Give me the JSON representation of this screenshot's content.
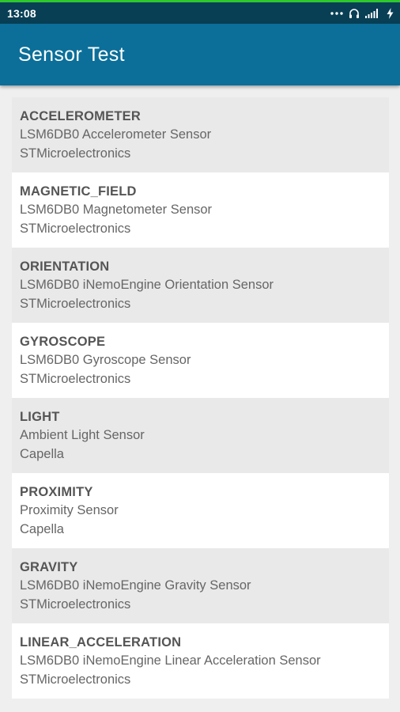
{
  "status_bar": {
    "time": "13:08",
    "icons": [
      "more-dots-icon",
      "headphones-icon",
      "signal-icon",
      "charging-icon"
    ]
  },
  "app_bar": {
    "title": "Sensor Test"
  },
  "colors": {
    "status_bar": "#083f55",
    "accent_line": "#2ec72e",
    "app_bar": "#0b6f99",
    "row_alt": "#e9e9e9"
  },
  "sensors": [
    {
      "type": "ACCELEROMETER",
      "name": "LSM6DB0 Accelerometer Sensor",
      "vendor": "STMicroelectronics"
    },
    {
      "type": "MAGNETIC_FIELD",
      "name": "LSM6DB0 Magnetometer Sensor",
      "vendor": "STMicroelectronics"
    },
    {
      "type": "ORIENTATION",
      "name": "LSM6DB0 iNemoEngine Orientation Sensor",
      "vendor": "STMicroelectronics"
    },
    {
      "type": "GYROSCOPE",
      "name": "LSM6DB0 Gyroscope Sensor",
      "vendor": "STMicroelectronics"
    },
    {
      "type": "LIGHT",
      "name": "Ambient Light Sensor",
      "vendor": "Capella"
    },
    {
      "type": "PROXIMITY",
      "name": "Proximity Sensor",
      "vendor": "Capella"
    },
    {
      "type": "GRAVITY",
      "name": "LSM6DB0 iNemoEngine Gravity Sensor",
      "vendor": "STMicroelectronics"
    },
    {
      "type": "LINEAR_ACCELERATION",
      "name": "LSM6DB0 iNemoEngine Linear Acceleration Sensor",
      "vendor": "STMicroelectronics"
    }
  ]
}
